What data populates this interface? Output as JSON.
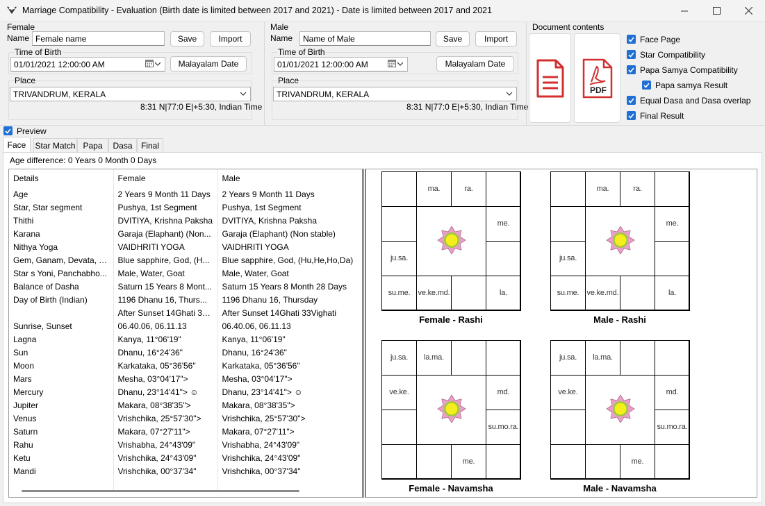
{
  "window": {
    "title": "Marriage  Compatibility - Evaluation  (Birth date is limited between 2017 and 2021)  - Date is limited between 2017 and 2021"
  },
  "female": {
    "section_label": "Female",
    "name_label": "Name",
    "name_value": "Female name",
    "save_label": "Save",
    "import_label": "Import",
    "time_group_label": "Time of Birth",
    "datetime_value": "01/01/2021  12:00:00 AM",
    "malayalam_date_label": "Malayalam Date",
    "place_group_label": "Place",
    "place_value": "TRIVANDRUM, KERALA",
    "coords": "8:31 N|77:0 E|+5:30, Indian Time"
  },
  "male": {
    "section_label": "Male",
    "name_label": "Name",
    "name_value": "Name of Male",
    "save_label": "Save",
    "import_label": "Import",
    "time_group_label": "Time of Birth",
    "datetime_value": "01/01/2021  12:00:00 AM",
    "malayalam_date_label": "Malayalam Date",
    "place_group_label": "Place",
    "place_value": "TRIVANDRUM, KERALA",
    "coords": "8:31 N|77:0 E|+5:30, Indian Time"
  },
  "document": {
    "group_label": "Document contents",
    "pdf_text": "PDF",
    "options": [
      {
        "label": "Face Page",
        "checked": true
      },
      {
        "label": "Star Compatibility",
        "checked": true
      },
      {
        "label": "Papa Samya Compatibility",
        "checked": true
      },
      {
        "label": "Papa samya Result",
        "checked": true
      },
      {
        "label": "Equal Dasa and Dasa overlap",
        "checked": true
      },
      {
        "label": "Final Result",
        "checked": true
      }
    ]
  },
  "preview": {
    "label": "Preview",
    "checked": true
  },
  "tabs": [
    "Face",
    "Star Match",
    "Papa",
    "Dasa",
    "Final"
  ],
  "age_difference": "Age difference: 0 Years 0 Month 0 Days",
  "table": {
    "headers": [
      "Details",
      "Female",
      "Male"
    ],
    "rows": [
      [
        "Age",
        "2 Years 9 Month 11 Days",
        "2 Years 9 Month 11 Days"
      ],
      [
        "Star, Star segment",
        "Pushya, 1st Segment",
        "Pushya, 1st Segment"
      ],
      [
        "Thithi",
        "DVITIYA, Krishna Paksha",
        "DVITIYA, Krishna Paksha"
      ],
      [
        "Karana",
        "Garaja (Elaphant) (Non...",
        "Garaja (Elaphant) (Non stable)"
      ],
      [
        "Nithya Yoga",
        "VAIDHRITI YOGA",
        "VAIDHRITI YOGA"
      ],
      [
        "Gem, Ganam, Devata, T...",
        "Blue sapphire, God, (H...",
        "Blue sapphire, God, (Hu,He,Ho,Da)"
      ],
      [
        "Star s Yoni, Panchabho...",
        "Male, Water, Goat",
        "Male, Water, Goat"
      ],
      [
        "Balance of Dasha",
        "Saturn 15 Years 8 Mont...",
        "Saturn 15 Years 8 Month 28 Days"
      ],
      [
        "Day of Birth (Indian)",
        "1196 Dhanu  16, Thurs...",
        "1196 Dhanu  16, Thursday"
      ],
      [
        "",
        "After Sunset 14Ghati 33...",
        "After Sunset 14Ghati 33Vighati"
      ],
      [
        "Sunrise, Sunset",
        "06.40.06, 06.11.13",
        "06.40.06, 06.11.13"
      ],
      [
        "Lagna",
        "Kanya, 11°06'19\"",
        "Kanya, 11°06'19\""
      ],
      [
        "Sun",
        "Dhanu, 16°24'36\"",
        "Dhanu, 16°24'36\""
      ],
      [
        "Moon",
        "Karkataka, 05°36'56\"",
        "Karkataka, 05°36'56\""
      ],
      [
        "Mars",
        "Mesha, 03°04'17\">",
        "Mesha, 03°04'17\">"
      ],
      [
        "Mercury",
        "Dhanu, 23°14'41\"> ☺",
        "Dhanu, 23°14'41\"> ☺"
      ],
      [
        "Jupiter",
        "Makara, 08°38'35\">",
        "Makara, 08°38'35\">"
      ],
      [
        "Venus",
        "Vrishchika, 25°57'30\">",
        "Vrishchika, 25°57'30\">"
      ],
      [
        "Saturn",
        "Makara, 07°27'11\">",
        "Makara, 07°27'11\">"
      ],
      [
        "Rahu",
        "Vrishabha, 24°43'09\"",
        "Vrishabha, 24°43'09\""
      ],
      [
        "Ketu",
        "Vrishchika, 24°43'09\"",
        "Vrishchika, 24°43'09\""
      ],
      [
        "Mandi",
        "Vrishchika, 00°37'34\"",
        "Vrishchika, 00°37'34\""
      ]
    ]
  },
  "charts": [
    {
      "title": "Female - Rashi",
      "cells": [
        "",
        "ma.",
        "ra.",
        "",
        "me.",
        "",
        "la.",
        "",
        "ve.ke.md.",
        "su.me.",
        "ju.sa.",
        ""
      ]
    },
    {
      "title": "Male - Rashi",
      "cells": [
        "",
        "ma.",
        "ra.",
        "",
        "me.",
        "",
        "la.",
        "",
        "ve.ke.md.",
        "su.me.",
        "ju.sa.",
        ""
      ]
    },
    {
      "title": "Female - Navamsha",
      "cells": [
        "ju.sa.",
        "la.ma.",
        "",
        "",
        "md.",
        "su.mo.ra.",
        "",
        "me.",
        "",
        "",
        "",
        "ve.ke."
      ]
    },
    {
      "title": "Male - Navamsha",
      "cells": [
        "ju.sa.",
        "la.ma.",
        "",
        "",
        "md.",
        "su.mo.ra.",
        "",
        "me.",
        "",
        "",
        "",
        "ve.ke."
      ]
    }
  ]
}
